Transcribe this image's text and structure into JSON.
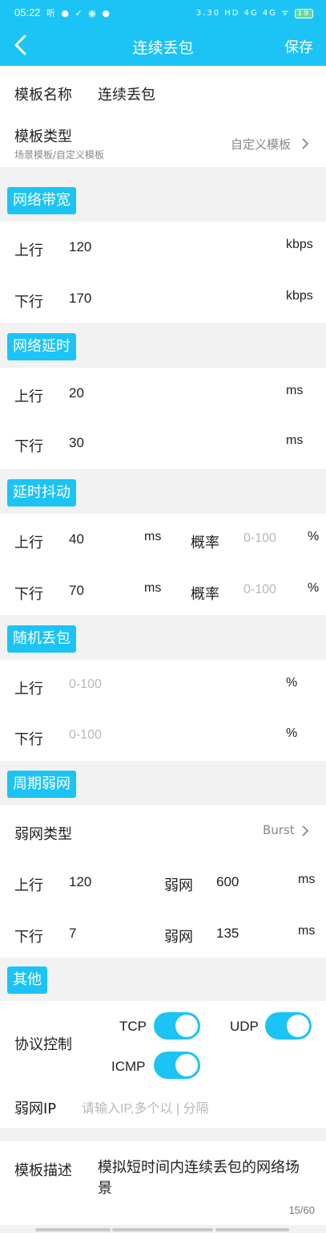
{
  "status": {
    "time": "05:22",
    "left_icons": "听 ● ✓ ◉ ●",
    "right_icons": "3.30 HD 4G 4G ᯤ",
    "battery": "19"
  },
  "header": {
    "title": "连续丢包",
    "save_label": "保存"
  },
  "template": {
    "name_label": "模板名称",
    "name_value": "连续丢包",
    "type_label": "模板类型",
    "type_sub": "场景模板/自定义模板",
    "type_value": "自定义模板"
  },
  "bandwidth": {
    "tag": "网络带宽",
    "up_label": "上行",
    "up_value": "120",
    "up_unit": "kbps",
    "down_label": "下行",
    "down_value": "170",
    "down_unit": "kbps"
  },
  "delay": {
    "tag": "网络延时",
    "up_label": "上行",
    "up_value": "20",
    "up_unit": "ms",
    "down_label": "下行",
    "down_value": "30",
    "down_unit": "ms"
  },
  "jitter": {
    "tag": "延时抖动",
    "up_label": "上行",
    "up_value": "40",
    "up_unit": "ms",
    "up_prob_label": "概率",
    "up_prob_ph": "0-100",
    "up_prob_unit": "%",
    "down_label": "下行",
    "down_value": "70",
    "down_unit": "ms",
    "down_prob_label": "概率",
    "down_prob_ph": "0-100",
    "down_prob_unit": "%"
  },
  "random_loss": {
    "tag": "随机丢包",
    "up_label": "上行",
    "up_ph": "0-100",
    "up_unit": "%",
    "down_label": "下行",
    "down_ph": "0-100",
    "down_unit": "%"
  },
  "periodic": {
    "tag": "周期弱网",
    "type_label": "弱网类型",
    "type_value": "Burst",
    "up_label": "上行",
    "up_value": "120",
    "up_weak_label": "弱网",
    "up_weak_value": "600",
    "up_unit": "ms",
    "down_label": "下行",
    "down_value": "7",
    "down_weak_label": "弱网",
    "down_weak_value": "135",
    "down_unit": "ms"
  },
  "other": {
    "tag": "其他",
    "protocol_label": "协议控制",
    "tcp": "TCP",
    "udp": "UDP",
    "icmp": "ICMP",
    "weak_ip_label": "弱网IP",
    "weak_ip_placeholder": "请输入IP,多个以 | 分隔"
  },
  "description": {
    "label": "模板描述",
    "text": "模拟短时间内连续丢包的网络场景",
    "counter": "15/60"
  },
  "colors": {
    "accent": "#1bc4f5"
  }
}
